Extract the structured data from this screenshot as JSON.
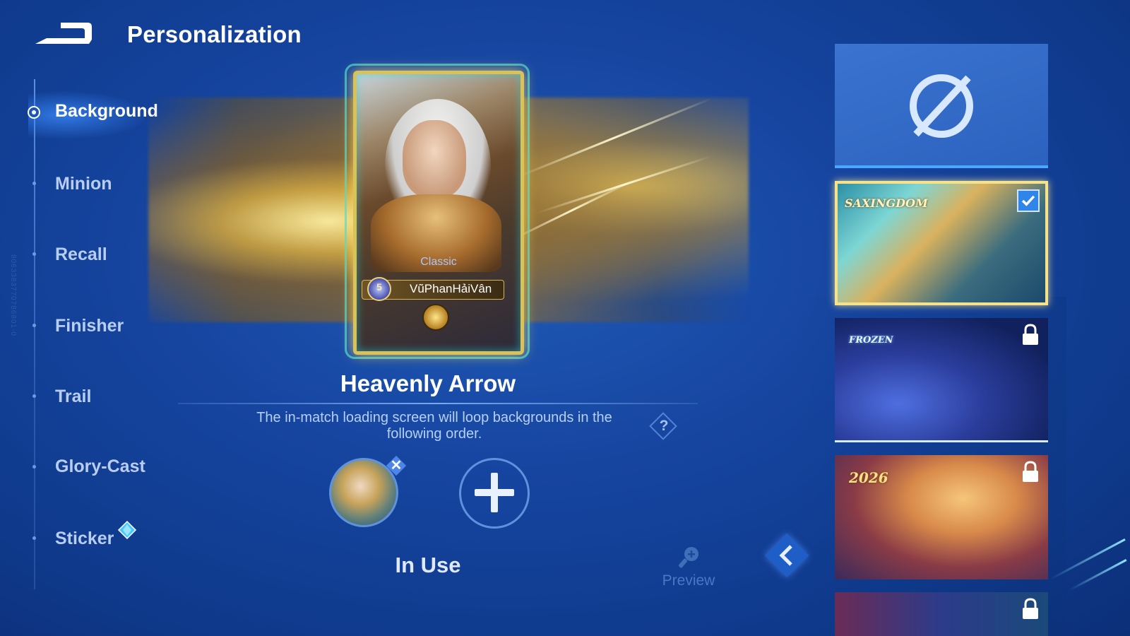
{
  "header": {
    "title": "Personalization",
    "back_icon": "back-arrow-icon"
  },
  "sidebar": {
    "items": [
      {
        "label": "Background",
        "active": true
      },
      {
        "label": "Minion"
      },
      {
        "label": "Recall"
      },
      {
        "label": "Finisher"
      },
      {
        "label": "Trail"
      },
      {
        "label": "Glory-Cast"
      },
      {
        "label": "Sticker",
        "badge_icon": "diamond-badge-icon"
      }
    ]
  },
  "side_id": "8063383770786801-0",
  "card": {
    "tier": "Classic",
    "player_name": "VũPhanHảiVân",
    "rank_number": "5"
  },
  "main": {
    "skin_name": "Heavenly Arrow",
    "description": "The in-match loading screen will loop backgrounds in the following order.",
    "help_label": "?",
    "status": "In Use",
    "preview_label": "Preview"
  },
  "options": {
    "heavenly_logo": "SAXINGDOM",
    "frozen_logo": "FROZEN",
    "new_year_logo": "2026"
  },
  "colors": {
    "accent_blue": "#49a7ff",
    "selected_border": "#f5e28a",
    "background": "#1645a0"
  }
}
